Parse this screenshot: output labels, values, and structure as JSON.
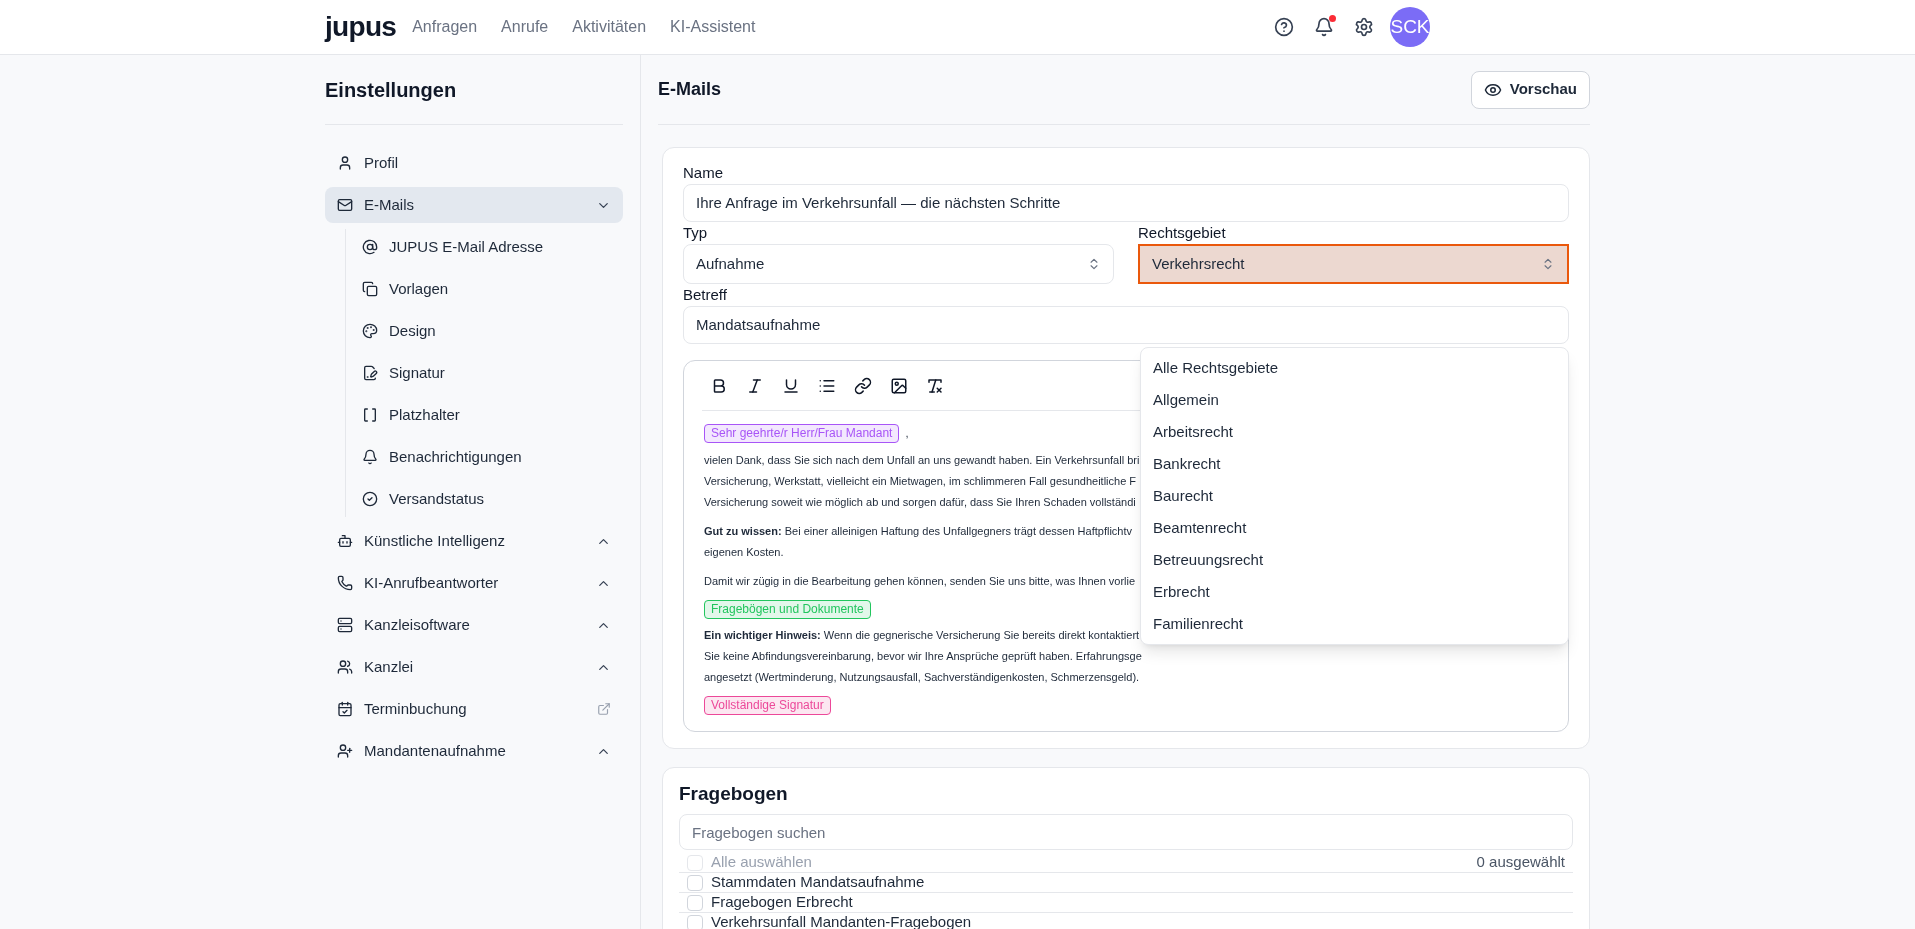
{
  "topbar": {
    "logo": "jupus",
    "nav": [
      "Anfragen",
      "Anrufe",
      "Aktivitäten",
      "KI-Assistent"
    ],
    "notifications_unread": true,
    "avatar": "SCK"
  },
  "sidebar": {
    "title": "Einstellungen",
    "items": [
      {
        "label": "Profil",
        "kind": "link",
        "selected": false
      },
      {
        "label": "E-Mails",
        "kind": "group",
        "selected": true,
        "expanded": true,
        "children": [
          {
            "label": "JUPUS E-Mail Adresse",
            "selected": false
          },
          {
            "label": "Vorlagen",
            "selected": false
          },
          {
            "label": "Design",
            "selected": false
          },
          {
            "label": "Signatur",
            "selected": false
          },
          {
            "label": "Platzhalter",
            "selected": false
          },
          {
            "label": "Benachrichtigungen",
            "selected": false
          },
          {
            "label": "Versandstatus",
            "selected": false
          }
        ]
      },
      {
        "label": "Künstliche Intelligenz",
        "kind": "group",
        "selected": false,
        "expanded": false
      },
      {
        "label": "KI-Anrufbeantworter",
        "kind": "group",
        "selected": false,
        "expanded": false
      },
      {
        "label": "Kanzleisoftware",
        "kind": "group",
        "selected": false,
        "expanded": false
      },
      {
        "label": "Kanzlei",
        "kind": "group",
        "selected": false,
        "expanded": false
      },
      {
        "label": "Terminbuchung",
        "kind": "external",
        "selected": false
      },
      {
        "label": "Mandantenaufnahme",
        "kind": "group",
        "selected": false,
        "expanded": false
      }
    ]
  },
  "main": {
    "title": "E-Mails",
    "preview_button": "Vorschau"
  },
  "form": {
    "name": {
      "label": "Name",
      "value": "Ihre Anfrage im Verkehrsunfall — die nächsten Schritte"
    },
    "typ": {
      "label": "Typ",
      "value": "Aufnahme"
    },
    "rechtsgebiet": {
      "label": "Rechtsgebiet",
      "value": "Verkehrsrecht",
      "focused": true,
      "open": true,
      "options": [
        "Alle Rechtsgebiete",
        "Allgemein",
        "Arbeitsrecht",
        "Bankrecht",
        "Baurecht",
        "Beamtenrecht",
        "Betreuungsrecht",
        "Erbrecht",
        "Familienrecht"
      ]
    },
    "betreff": {
      "label": "Betreff",
      "value": "Mandatsaufnahme"
    }
  },
  "editor": {
    "blocks": [
      {
        "kind": "chip",
        "text": "Sehr geehrte/r Herr/Frau Mandant",
        "color": "#a855f7",
        "after": ","
      },
      {
        "kind": "paragraph",
        "lines": [
          "vielen Dank, dass Sie sich nach dem Unfall an uns gewandt haben. Ein Verkehrsunfall bri",
          "Versicherung, Werkstatt, vielleicht ein Mietwagen, im schlimmeren Fall gesundheitliche F",
          "Versicherung soweit wie möglich ab und sorgen dafür, dass Sie Ihren Schaden vollständi"
        ]
      },
      {
        "kind": "paragraph",
        "lines": [
          "**Gut zu wissen:** Bei einer alleinigen Haftung des Unfallgegners trägt dessen Haftpflichtv",
          "eigenen Kosten."
        ]
      },
      {
        "kind": "paragraph",
        "lines": [
          "Damit wir zügig in die Bearbeitung gehen können, senden Sie uns bitte, was Ihnen vorlie"
        ]
      },
      {
        "kind": "chip",
        "text": "Fragebögen und Dokumente",
        "color": "#22c55e"
      },
      {
        "kind": "paragraph",
        "lines": [
          "**Ein wichtiger Hinweis:** Wenn die gegnerische Versicherung Sie bereits direkt kontaktiert",
          "Sie keine Abfindungsvereinbarung, bevor wir Ihre Ansprüche geprüft haben. Erfahrungsge",
          "angesetzt (Wertminderung, Nutzungsausfall, Sachverständigenkosten, Schmerzensgeld)."
        ]
      },
      {
        "kind": "chip",
        "text": "Vollständige Signatur",
        "color": "#ec4899"
      }
    ]
  },
  "fragebogen": {
    "title": "Fragebogen",
    "search": {
      "placeholder": "Fragebogen suchen"
    },
    "select_all": {
      "label": "Alle auswählen",
      "checked": false,
      "disabled": true
    },
    "count": "0 ausgewählt",
    "items": [
      {
        "label": "Stammdaten Mandatsaufnahme",
        "checked": false
      },
      {
        "label": "Fragebogen Erbrecht",
        "checked": false
      },
      {
        "label": "Verkehrsunfall Mandanten-Fragebogen",
        "checked": false
      }
    ]
  }
}
